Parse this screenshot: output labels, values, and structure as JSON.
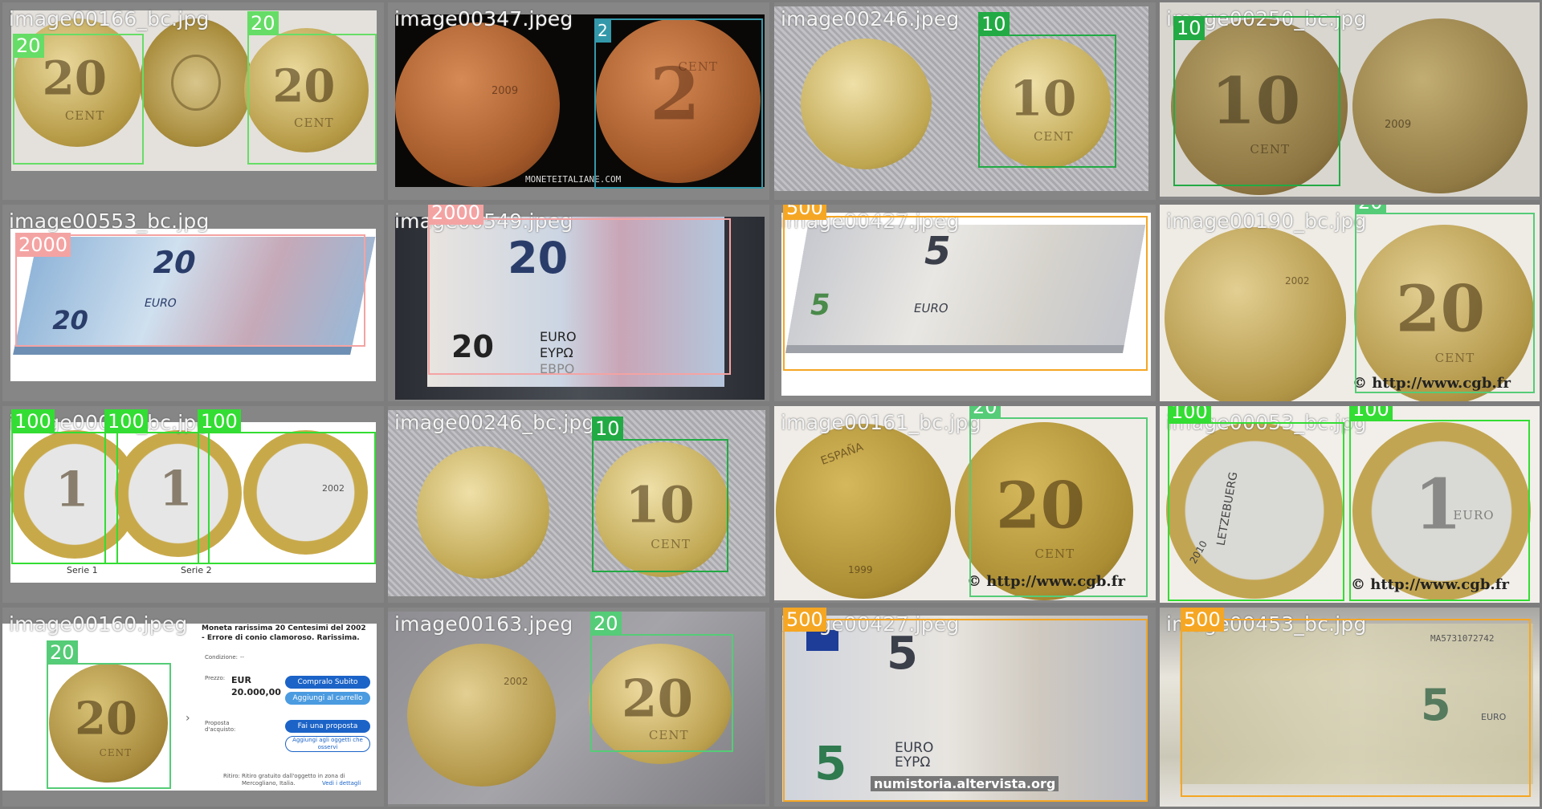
{
  "tiles": [
    {
      "filename": "image00166_bc.jpg",
      "boxes": [
        {
          "label": "20",
          "color": "#66dd66"
        },
        {
          "label": "20",
          "color": "#66dd66"
        }
      ]
    },
    {
      "filename": "image00347.jpeg",
      "overlay_text": "MONETEITALIANE.COM",
      "coin_year": "2009",
      "boxes": [
        {
          "label": "2",
          "color": "#3399aa"
        }
      ]
    },
    {
      "filename": "image00246.jpeg",
      "boxes": [
        {
          "label": "10",
          "color": "#22aa44"
        }
      ]
    },
    {
      "filename": "image00250_bc.jpg",
      "coin_year": "2009",
      "boxes": [
        {
          "label": "10",
          "color": "#22aa44"
        }
      ]
    },
    {
      "filename": "image00553_bc.jpg",
      "boxes": [
        {
          "label": "2000",
          "color": "#f4a3a3"
        }
      ]
    },
    {
      "filename": "image00549.jpeg",
      "boxes": [
        {
          "label": "2000",
          "color": "#f4a3a3"
        }
      ]
    },
    {
      "filename": "image00427.jpeg",
      "boxes": [
        {
          "label": "500",
          "color": "#f5a623"
        }
      ]
    },
    {
      "filename": "image00190_bc.jpg",
      "overlay_text": "© http://www.cgb.fr",
      "coin_year": "2002",
      "boxes": [
        {
          "label": "20",
          "color": "#55cc77"
        }
      ]
    },
    {
      "filename": "image00046_bc.jpg",
      "captions": [
        "Serie 1",
        "Serie 2"
      ],
      "coin_year": "2002",
      "boxes": [
        {
          "label": "100",
          "color": "#33dd33"
        },
        {
          "label": "100",
          "color": "#33dd33"
        },
        {
          "label": "100",
          "color": "#33dd33"
        }
      ]
    },
    {
      "filename": "image00246_bc.jpg",
      "boxes": [
        {
          "label": "10",
          "color": "#22aa44"
        }
      ]
    },
    {
      "filename": "image00161_bc.jpg",
      "overlay_text": "© http://www.cgb.fr",
      "coin_text": "ESPAÑA",
      "coin_year": "1999",
      "boxes": [
        {
          "label": "20",
          "color": "#55cc77"
        }
      ]
    },
    {
      "filename": "image00053_bc.jpg",
      "overlay_text": "© http://www.cgb.fr",
      "coin_text": "LETZEBUERG",
      "coin_year": "2010",
      "boxes": [
        {
          "label": "100",
          "color": "#33dd33"
        },
        {
          "label": "100",
          "color": "#33dd33"
        }
      ]
    },
    {
      "filename": "image00160.jpeg",
      "boxes": [
        {
          "label": "20",
          "color": "#55cc77"
        }
      ],
      "listing": {
        "title": "Moneta rarissima 20 Centesimi del 2002 - Errore di conio clamoroso. Rarissima.",
        "condition_label": "Condizione:",
        "condition_value": "--",
        "price_label": "Prezzo:",
        "currency": "EUR",
        "price": "20.000,00",
        "buy_now": "Compralo Subito",
        "add_to_cart": "Aggiungi al carrello",
        "offer_label": "Proposta d'acquisto:",
        "make_offer": "Fai una proposta",
        "watchlist": "Aggiungi agli oggetti che osservi",
        "shipping_label": "Ritiro:",
        "shipping_value": "Ritiro gratuito dall'oggetto in zona di Mercogliano, Italia.",
        "details_link": "Vedi i dettagli"
      }
    },
    {
      "filename": "image00163.jpeg",
      "coin_year": "2002",
      "boxes": [
        {
          "label": "20",
          "color": "#55cc77"
        }
      ]
    },
    {
      "filename": "image00427.jpeg",
      "overlay_text": "numistoria.altervista.org",
      "boxes": [
        {
          "label": "500",
          "color": "#f5a623"
        }
      ]
    },
    {
      "filename": "image00453_bc.jpg",
      "serial": "MA5731072742",
      "boxes": [
        {
          "label": "500",
          "color": "#f5a623"
        }
      ]
    }
  ],
  "banknote": {
    "euro_word": "EURO",
    "greek_word": "ΕΥΡΩ",
    "bg_word": "ЕВРО",
    "value_20": "20",
    "value_5": "5"
  },
  "coin_words": {
    "cent": "CENT",
    "euro": "EURO"
  },
  "colors": {
    "grid_gap": "#7d7d7d",
    "tile_bg": "#868686",
    "class_20": "#55cc77",
    "class_10": "#22aa44",
    "class_2": "#3399aa",
    "class_2000": "#f4a3a3",
    "class_500": "#f5a623",
    "class_100": "#33dd33"
  }
}
